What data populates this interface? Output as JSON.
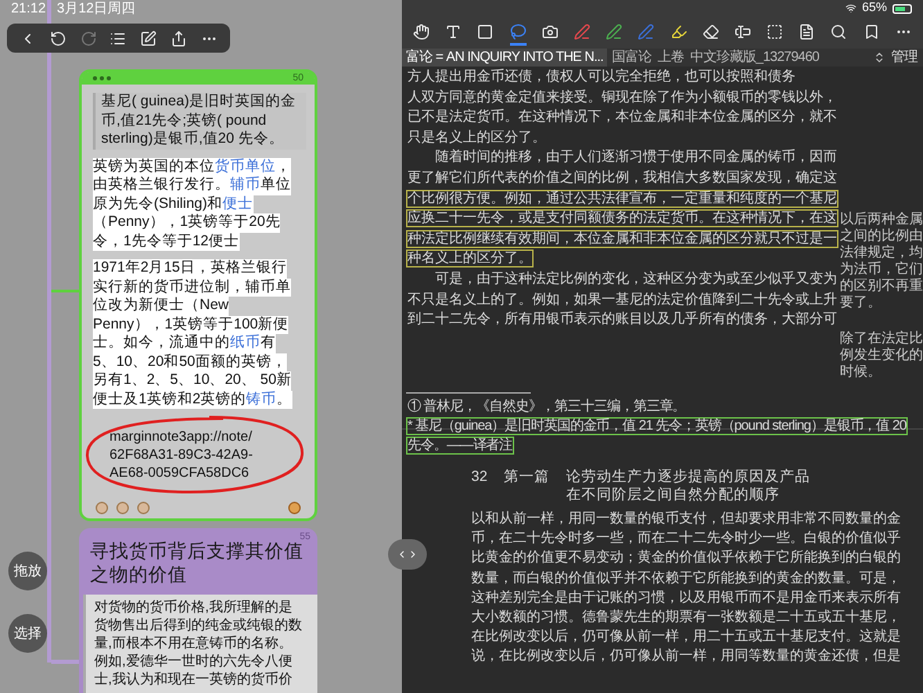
{
  "status_bar": {
    "time": "21:12",
    "date": "3月12日周四",
    "battery": "65%"
  },
  "mindmap_toolbar": [
    {
      "kind": "back",
      "disabled": false
    },
    {
      "kind": "undo",
      "disabled": false
    },
    {
      "kind": "redo",
      "disabled": true
    },
    {
      "kind": "list",
      "disabled": false
    },
    {
      "kind": "edit",
      "disabled": false
    },
    {
      "kind": "share",
      "disabled": false
    },
    {
      "kind": "more",
      "disabled": false
    }
  ],
  "side_buttons": [
    "拖放",
    "选择"
  ],
  "note_card": {
    "badge": "50",
    "quote": "基尼( guinea)是旧时英国的金币,值21先令;英镑( pound sterling)是银币,值20 先令。",
    "paragraphs": [
      [
        [
          {
            "text": "英镑为英国的本位",
            "link": false
          },
          {
            "text": "货币单位",
            "link": true
          },
          {
            "text": "，",
            "link": false
          }
        ],
        [
          {
            "text": "由英格兰银行发行。",
            "link": false
          },
          {
            "text": "辅币",
            "link": true
          },
          {
            "text": "单位",
            "link": false
          }
        ],
        [
          {
            "text": "原为先令(Shiling)和",
            "link": false
          },
          {
            "text": "便士",
            "link": true
          }
        ],
        [
          {
            "text": "（Penny），1英镑等于20先",
            "link": false
          }
        ],
        [
          {
            "text": "令，1先令等于12便士",
            "link": false
          }
        ]
      ],
      [
        [
          {
            "text": "1971年2月15日，英格兰银行",
            "link": false
          }
        ],
        [
          {
            "text": "实行新的货币进位制，辅币单",
            "link": false
          }
        ],
        [
          {
            "text": "位改为新便士（New",
            "link": false
          }
        ],
        [
          {
            "text": "Penny），1英镑等于100新便",
            "link": false
          }
        ],
        [
          {
            "text": "士。如今，流通中的",
            "link": false
          },
          {
            "text": "纸币",
            "link": true
          },
          {
            "text": "有",
            "link": false
          }
        ],
        [
          {
            "text": "5、10、20和50面额的英镑，",
            "link": false
          }
        ],
        [
          {
            "text": "另有1、2、5、10、20、 50新",
            "link": false
          }
        ],
        [
          {
            "text": "便士及1英镑和2英镑的",
            "link": false
          },
          {
            "text": "铸币",
            "link": true
          },
          {
            "text": "。",
            "link": false
          }
        ]
      ]
    ],
    "note_link": [
      "marginnote3app://note/",
      "62F68A31-89C3-42A9-",
      "AE68-0059CFA58DC6"
    ]
  },
  "topic_card": {
    "badge": "55",
    "title": [
      "寻找货币背后支撑其价值",
      "之物的价值"
    ],
    "excerpt": [
      "对货物的货币价格,我所理解的是",
      "货物售出后得到的纯金或纯银的数",
      "量,而根本不用在意铸币的名称。",
      "例如,爱德华一世时的六先令八便",
      "士,我认为和现在一英镑的货币价"
    ]
  },
  "reader_toolbar": [
    {
      "kind": "hand",
      "selected": false,
      "color": "#e8e8e8"
    },
    {
      "kind": "highlight-text",
      "selected": false,
      "color": "#e8e8e8"
    },
    {
      "kind": "rect-select",
      "selected": false,
      "color": "#e8e8e8"
    },
    {
      "kind": "lasso",
      "selected": true,
      "color": "#3b82f6"
    },
    {
      "kind": "screenshot",
      "selected": false,
      "color": "#e8e8e8"
    },
    {
      "kind": "pen",
      "selected": false,
      "color": "#e5484d"
    },
    {
      "kind": "pen",
      "selected": false,
      "color": "#4caf50"
    },
    {
      "kind": "pen",
      "selected": false,
      "color": "#3b6fd8"
    },
    {
      "kind": "marker",
      "selected": false,
      "color": "#e5d53a"
    },
    {
      "kind": "eraser",
      "selected": false,
      "color": "#e8e8e8"
    },
    {
      "kind": "textbox",
      "selected": false,
      "color": "#e8e8e8"
    },
    {
      "kind": "dashed-box",
      "selected": false,
      "color": "#e8e8e8"
    },
    {
      "kind": "document",
      "selected": false,
      "color": "#e8e8e8"
    },
    {
      "kind": "search",
      "selected": false,
      "color": "#e8e8e8"
    },
    {
      "kind": "bookmark",
      "selected": false,
      "color": "#e8e8e8"
    },
    {
      "kind": "more",
      "selected": false,
      "color": "#e8e8e8"
    }
  ],
  "tabs": [
    {
      "label": "富论 = AN INQUIRY INTO THE N...",
      "selected": true
    },
    {
      "label": "国富论  上卷  中文珍藏版_13279460",
      "selected": false
    }
  ],
  "manage_button": "管理",
  "page_1": {
    "lines": [
      {
        "text": "方人提出用金币还债，债权人可以完全拒绝，也可以按照和债务",
        "boxed": false
      },
      {
        "text": "人双方同意的黄金定值来接受。铜现在除了作为小额银币的零钱以外，",
        "boxed": false
      },
      {
        "text": "已不是法定货币。在这种情况下，本位金属和非本位金属的区分，就不",
        "boxed": false
      },
      {
        "text": "只是名义上的区分了。",
        "boxed": false
      },
      {
        "text": "　　随着时间的推移，由于人们逐渐习惯于使用不同金属的铸币，因而",
        "boxed": false
      },
      {
        "text": "更了解它们所代表的价值之间的比例，我相信大多数国家发现，确定这",
        "boxed": false
      },
      {
        "text": "个比例很方便。例如，通过公共法律宣布，一定重量和纯度的一个基尼",
        "boxed": true
      },
      {
        "text": "应换二十一先令，或是支付同额债务的法定货币。在这种情况下，在这",
        "boxed": true
      },
      {
        "text": "种法定比例继续有效期间，本位金属和非本位金属的区分就只不过是一",
        "boxed": true
      },
      {
        "text": "种名义上的区分了。",
        "boxed": true
      },
      {
        "text": "　　可是，由于这种法定比例的变化，这种区分变为或至少似乎又变为",
        "boxed": false
      },
      {
        "text": "不只是名义上的了。例如，如果一基尼的法定价值降到二十先令或上升",
        "boxed": false
      },
      {
        "text": "到二十二先令，所有用银币表示的账目以及几乎所有的债务，大部分可",
        "boxed": false
      }
    ],
    "side_notes": [
      [
        "以后两种金属",
        "之间的比例由",
        "法律规定，均",
        "为法币，它们",
        "的区别不再重",
        "要了。"
      ],
      [
        "除了在法定比",
        "例发生变化的",
        "时候。"
      ]
    ],
    "footnotes": [
      {
        "text": "① 普林尼，《自然史》，第三十三编，第三章。",
        "boxed": false
      },
      {
        "text": "* 基尼（guinea）是旧时英国的金币，值 21 先令；英镑（pound sterling）是银币，值 20",
        "boxed": true
      },
      {
        "text": "先令。——译者注",
        "boxed": true
      }
    ]
  },
  "page_2": {
    "page_number": "32",
    "part": "第一篇",
    "heading": [
      "论劳动生产力逐步提高的原因及产品",
      "在不同阶层之间自然分配的顺序"
    ],
    "lines": [
      "以和从前一样，用同一数量的银币支付，但却要求用非常不同数量的金",
      "币，在二十先令时多一些，而在二十二先令时少一些。白银的价值似乎",
      "比黄金的价值更不易变动；黄金的价值似乎依赖于它所能换到的白银的",
      "数量，而白银的价值似乎并不依赖于它所能换到的黄金的数量。可是，",
      "这种差别完全是由于记账的习惯，以及用银币而不是用金币来表示所有",
      "大小数额的习惯。德鲁蒙先生的期票有一张数额是二十五或五十基尼，",
      "在比例改变以后，仍可像从前一样，用二十五或五十基尼支付。这就是",
      "说，在比例改变以后，仍可像从前一样，用同等数量的黄金还债，但是"
    ]
  }
}
